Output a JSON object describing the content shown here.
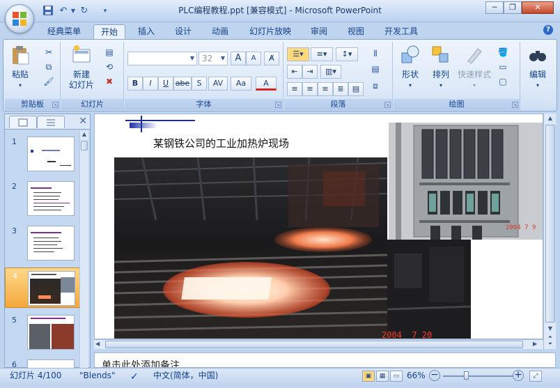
{
  "window": {
    "title": "PLC编程教程.ppt [兼容模式] - Microsoft PowerPoint",
    "minimize_label": "─",
    "restore_label": "❐",
    "close_label": "✕"
  },
  "quick_access": {
    "save_icon": "save-icon",
    "undo_icon": "undo-icon",
    "redo_icon": "redo-icon",
    "customize_icon": "dropdown-icon"
  },
  "tabs": [
    {
      "label": "经典菜单",
      "active": false
    },
    {
      "label": "开始",
      "active": true
    },
    {
      "label": "插入",
      "active": false
    },
    {
      "label": "设计",
      "active": false
    },
    {
      "label": "动画",
      "active": false
    },
    {
      "label": "幻灯片放映",
      "active": false
    },
    {
      "label": "审阅",
      "active": false
    },
    {
      "label": "视图",
      "active": false
    },
    {
      "label": "开发工具",
      "active": false
    }
  ],
  "ribbon": {
    "clipboard": {
      "label": "剪贴板",
      "paste": "粘贴"
    },
    "slides": {
      "label": "幻灯片",
      "new_slide_line1": "新建",
      "new_slide_line2": "幻灯片"
    },
    "font": {
      "label": "字体",
      "font_name": "",
      "font_size": "32",
      "bold": "B",
      "italic": "I",
      "underline": "U",
      "strike": "abe",
      "shadow": "S",
      "spacing": "AV",
      "case": "Aa",
      "color": "A",
      "grow": "A",
      "shrink": "A"
    },
    "paragraph": {
      "label": "段落"
    },
    "drawing": {
      "label": "绘图",
      "shapes": "形状",
      "arrange": "排列",
      "quick_styles": "快速样式"
    },
    "editing": {
      "label": "编辑"
    }
  },
  "slides_panel": {
    "close_label": "✕",
    "thumbnails": [
      {
        "number": "1",
        "selected": false
      },
      {
        "number": "2",
        "selected": false
      },
      {
        "number": "3",
        "selected": false
      },
      {
        "number": "4",
        "selected": true
      },
      {
        "number": "5",
        "selected": false
      },
      {
        "number": "6",
        "selected": false
      }
    ]
  },
  "slide": {
    "caption": "某钢铁公司的工业加热炉现场",
    "photo_date": "2004  7 20",
    "cabinet_date": "2004 7 9"
  },
  "notes": {
    "placeholder": "单击此处添加备注"
  },
  "status": {
    "slide_info": "幻灯片 4/100",
    "theme": "\"Blends\"",
    "language": "中文(简体，中国)",
    "zoom": "66%",
    "zoom_level": 0.66
  },
  "colors": {
    "accent": "#15428b",
    "ribbon_bg": "#dde9f8",
    "selected_thumb": "#f5a83c"
  }
}
